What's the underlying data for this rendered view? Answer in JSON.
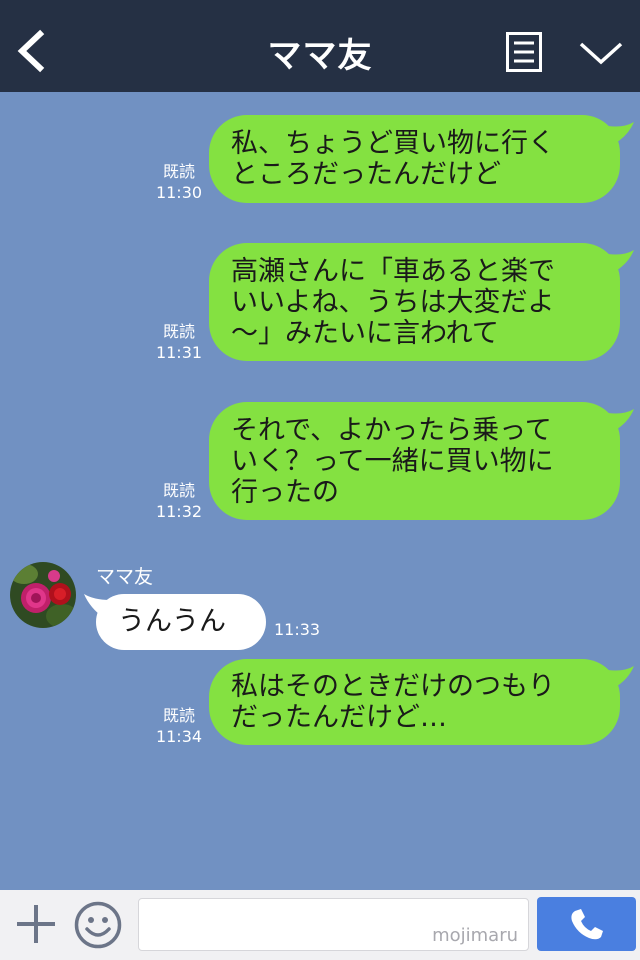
{
  "header": {
    "title": "ママ友"
  },
  "messages": [
    {
      "status": "既読",
      "time": "11:30",
      "lines": [
        "私、ちょうど買い物に行く",
        "ところだったんだけど"
      ]
    },
    {
      "status": "既読",
      "time": "11:31",
      "lines": [
        "高瀬さんに「車あると楽で",
        "いいよね、うちは大変だよ",
        "〜」みたいに言われて"
      ]
    },
    {
      "status": "既読",
      "time": "11:32",
      "lines": [
        "それで、よかったら乗って",
        "いく？って一緒に買い物に",
        "行ったの"
      ]
    },
    {
      "sender": "ママ友",
      "text": "うんうん",
      "time": "11:33"
    },
    {
      "status": "既読",
      "time": "11:34",
      "lines": [
        "私はそのときだけのつもり",
        "だったんだけど…"
      ]
    }
  ],
  "input": {
    "placeholder": "",
    "watermark": "mojimaru"
  },
  "colors": {
    "header_bg": "#253044",
    "chat_bg": "#7191c2",
    "bubble_out": "#84e141",
    "bubble_in": "#ffffff",
    "call_button": "#4a7fe0"
  },
  "icons": [
    "back-chevron-icon",
    "menu-list-icon",
    "chevron-down-icon",
    "plus-icon",
    "emoji-icon",
    "phone-icon"
  ]
}
